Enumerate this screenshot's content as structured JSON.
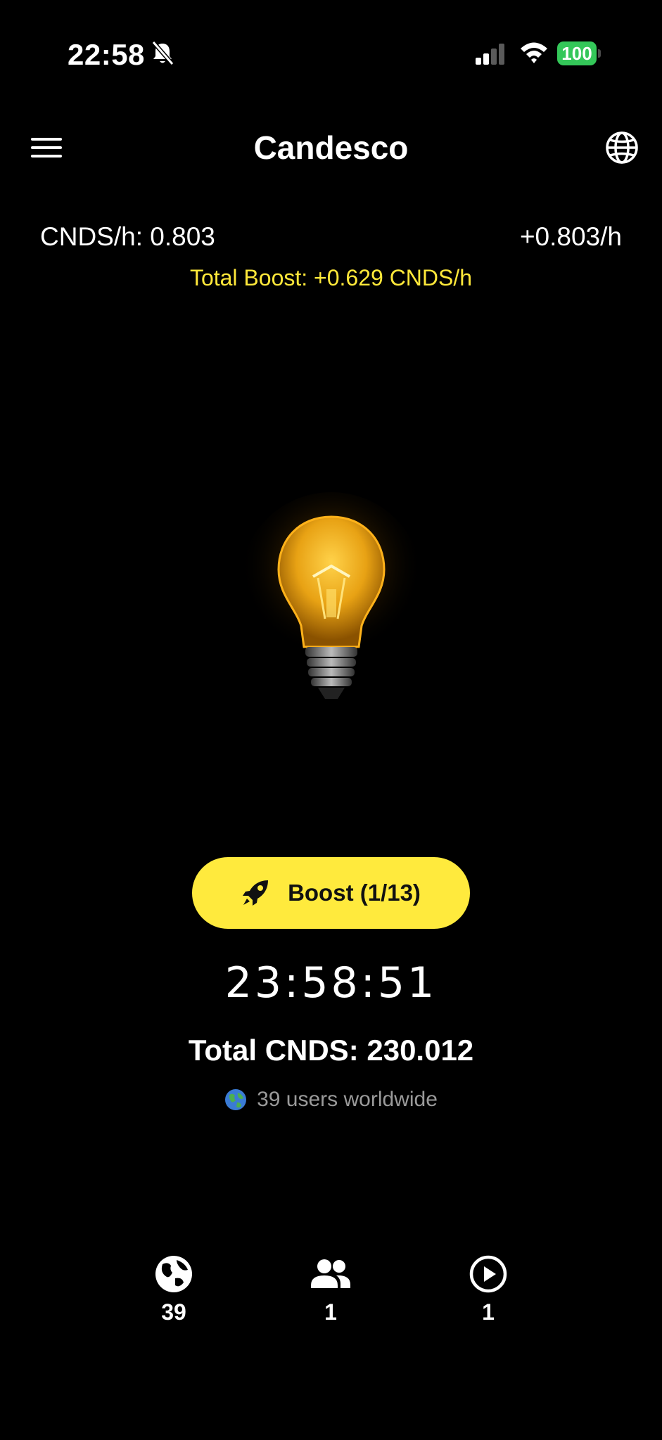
{
  "status_bar": {
    "time": "22:58",
    "battery": "100",
    "battery_color": "#34c759"
  },
  "header": {
    "title": "Candesco",
    "menu_icon": "hamburger-menu-icon",
    "language_icon": "globe-icon"
  },
  "stats": {
    "rate_label": "CNDS/h: 0.803",
    "rate_delta": "+0.803/h",
    "total_boost": "Total Boost: +0.629 CNDS/h"
  },
  "boost": {
    "label": "Boost (1/13)",
    "icon": "rocket-icon",
    "color": "#ffea3d"
  },
  "timer": "23:58:51",
  "total": "Total CNDS: 230.012",
  "users_line": {
    "text": "39 users worldwide",
    "icon": "earth-globe-emoji"
  },
  "bottom_stats": [
    {
      "icon": "globe-icon",
      "value": "39"
    },
    {
      "icon": "people-icon",
      "value": "1"
    },
    {
      "icon": "play-circle-icon",
      "value": "1"
    }
  ],
  "accent_color": "#ffe83a"
}
